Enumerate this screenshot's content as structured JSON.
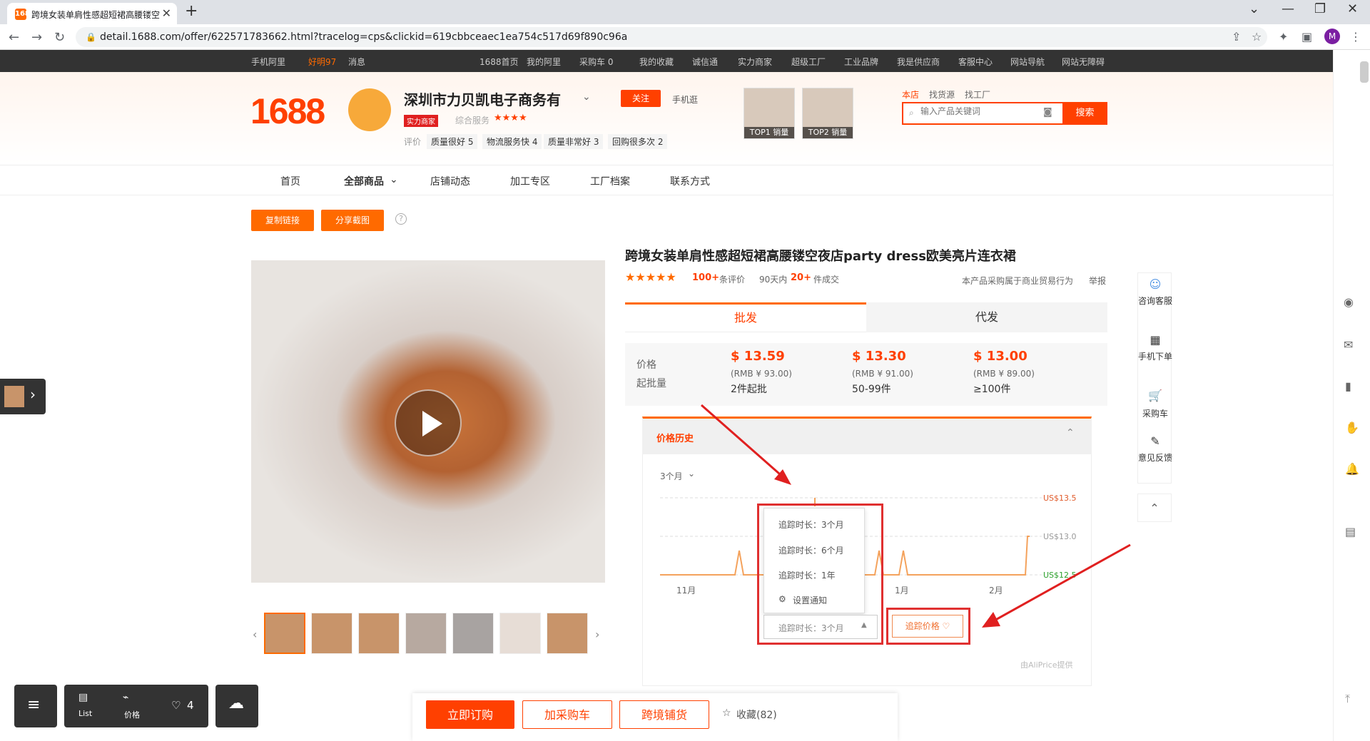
{
  "browser": {
    "tab_title": "跨境女装单肩性感超短裙高腰镂空",
    "url": "detail.1688.com/offer/622571783662.html?tracelog=cps&clickid=619cbbceaec1ea754c517d69f890c96a",
    "avatar_letter": "M",
    "favicon": "1688",
    "new_tab": "+",
    "close": "✕"
  },
  "topnav": {
    "items": [
      "手机阿里",
      "好明97",
      "消息",
      "1688首页",
      "我的阿里",
      "采购车 0",
      "我的收藏",
      "诚信通",
      "实力商家",
      "超级工厂",
      "工业品牌",
      "我是供应商",
      "客服中心",
      "网站导航",
      "网站无障碍"
    ]
  },
  "shop": {
    "logo": "1688",
    "name": "深圳市力贝凯电子商务有",
    "badge": "实力商家",
    "service_label": "综合服务",
    "follow": "关注",
    "mobile": "手机逛",
    "eval_label": "评价",
    "tags": [
      "质量很好 5",
      "物流服务快 4",
      "质量非常好 3",
      "回购很多次 2"
    ],
    "top1": "TOP1 销量",
    "top2": "TOP2 销量"
  },
  "search": {
    "tabs": [
      "本店",
      "找货源",
      "找工厂"
    ],
    "placeholder": "输入产品关键词",
    "button": "搜索"
  },
  "menu": [
    "首页",
    "全部商品",
    "店铺动态",
    "加工专区",
    "工厂档案",
    "联系方式"
  ],
  "actions": {
    "copy_link": "复制链接",
    "share_shot": "分享截图"
  },
  "product": {
    "title": "跨境女装单肩性感超短裙高腰镂空夜店party dress欧美亮片连衣裙",
    "stars": "★★★★★",
    "review_count": "100+",
    "review_label": "条评价",
    "sold_prefix": "90天内",
    "sold_count": "20+",
    "sold_label": "件成交",
    "notice": "本产品采购属于商业贸易行为",
    "report": "举报"
  },
  "tabs": {
    "wholesale": "批发",
    "dropship": "代发"
  },
  "pricing": {
    "price_label": "价格",
    "moq_label": "起批量",
    "tiers": [
      {
        "price": "$ 13.59",
        "rmb": "(RMB ¥ 93.00)",
        "qty": "2件起批"
      },
      {
        "price": "$ 13.30",
        "rmb": "(RMB ¥ 91.00)",
        "qty": "50-99件"
      },
      {
        "price": "$ 13.00",
        "rmb": "(RMB ¥ 89.00)",
        "qty": "≥100件"
      }
    ]
  },
  "history": {
    "title": "价格历史",
    "range": "3个月",
    "y_labels": [
      "US$13.5",
      "US$13.0",
      "US$12.5"
    ],
    "x_labels": [
      "11月",
      "1月",
      "2月"
    ],
    "dropdown": [
      "追踪时长：3个月",
      "追踪时长：6个月",
      "追踪时长：1年",
      "设置通知"
    ],
    "select_value": "追踪时长：3个月",
    "track_btn": "追踪价格",
    "provider": "由AliPrice提供"
  },
  "sidebar": [
    "咨询客服",
    "手机下单",
    "采购车",
    "意见反馈"
  ],
  "bottom": {
    "buy": "立即订购",
    "cart": "加采购车",
    "crossborder": "跨境铺货",
    "fav": "收藏(82)"
  },
  "float": {
    "list": "List",
    "price": "价格",
    "likes": "4"
  },
  "colors": {
    "accent": "#ff4000",
    "orange": "#ff6a00"
  }
}
